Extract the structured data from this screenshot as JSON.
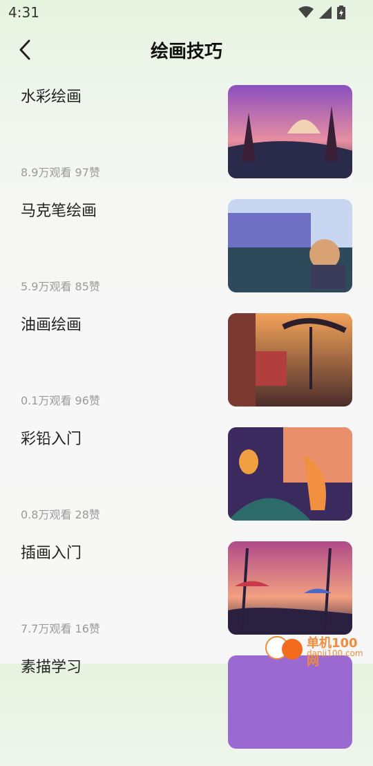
{
  "status_bar": {
    "time": "4:31",
    "wifi_icon": "wifi-icon",
    "signal_icon": "signal-icon",
    "battery_icon": "battery-charging-icon"
  },
  "header": {
    "title": "绘画技巧",
    "back_icon": "chevron-left-icon"
  },
  "items": [
    {
      "title": "水彩绘画",
      "stats": "8.9万观看 97赞"
    },
    {
      "title": "马克笔绘画",
      "stats": "5.9万观看 85赞"
    },
    {
      "title": "油画绘画",
      "stats": "0.1万观看 96赞"
    },
    {
      "title": "彩铅入门",
      "stats": "0.8万观看 28赞"
    },
    {
      "title": "插画入门",
      "stats": "7.7万观看 16赞"
    },
    {
      "title": "素描学习",
      "stats": ""
    }
  ],
  "watermark": {
    "name": "单机100网",
    "url": "danji100.com"
  },
  "colors": {
    "accent": "#f08c3a",
    "background_top": "#e6f3df"
  }
}
